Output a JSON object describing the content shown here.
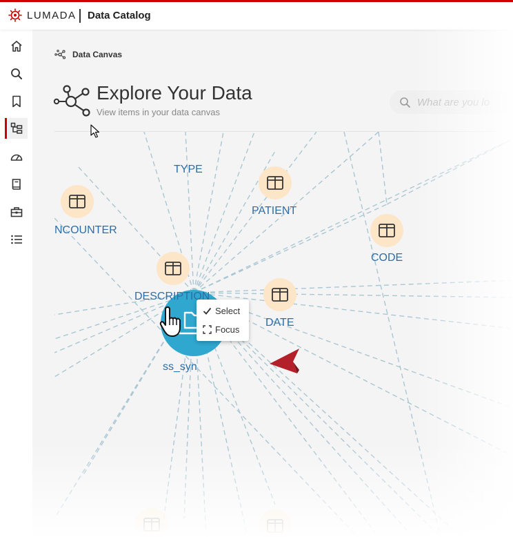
{
  "header": {
    "brand": "LUMADA",
    "app_title": "Data Catalog"
  },
  "sidebar": {
    "items": [
      {
        "icon": "home-icon"
      },
      {
        "icon": "search-icon"
      },
      {
        "icon": "bookmark-icon"
      },
      {
        "icon": "data-canvas-icon",
        "active": true
      },
      {
        "icon": "dashboard-icon"
      },
      {
        "icon": "book-icon"
      },
      {
        "icon": "toolbox-icon"
      },
      {
        "icon": "list-icon"
      }
    ]
  },
  "page": {
    "breadcrumb": "Data Canvas",
    "title": "Explore Your Data",
    "subtitle": "View items in your data canvas",
    "search_placeholder": "What are you lo"
  },
  "canvas": {
    "center_label": "ss_syn",
    "labels": {
      "type": "TYPE",
      "encounter": "NCOUNTER",
      "patient": "PATIENT",
      "code": "CODE",
      "description": "DESCRIPTION",
      "date": "DATE"
    }
  },
  "context_menu": {
    "select": "Select",
    "focus": "Focus"
  },
  "colors": {
    "brand_red": "#cc0000",
    "node_fill": "#fde5c8",
    "center_node": "#2fa7cf",
    "label_blue": "#2e6da4",
    "arrow": "#b3202a"
  }
}
